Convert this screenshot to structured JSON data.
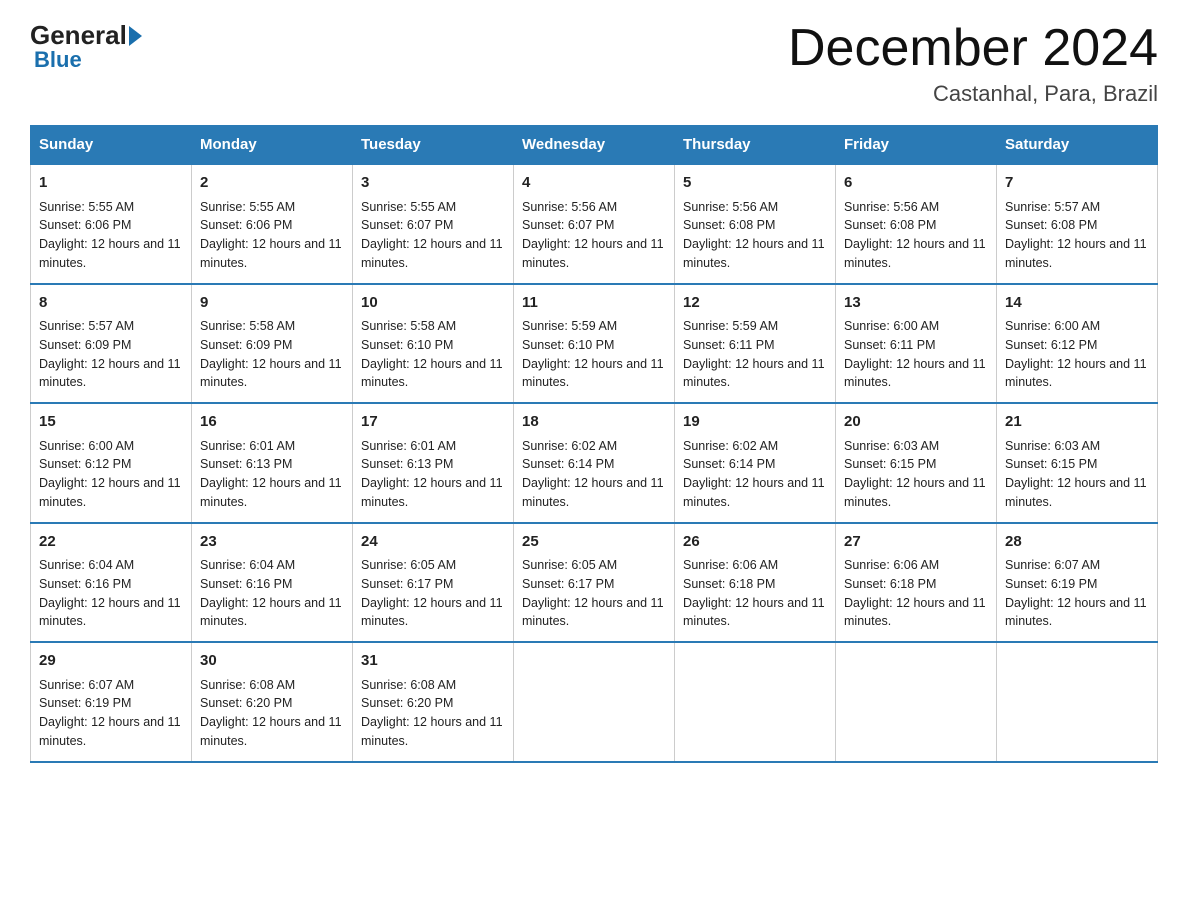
{
  "header": {
    "logo_general": "General",
    "logo_blue": "Blue",
    "title": "December 2024",
    "location": "Castanhal, Para, Brazil"
  },
  "days_of_week": [
    "Sunday",
    "Monday",
    "Tuesday",
    "Wednesday",
    "Thursday",
    "Friday",
    "Saturday"
  ],
  "weeks": [
    [
      {
        "day": "1",
        "sunrise": "5:55 AM",
        "sunset": "6:06 PM",
        "daylight": "12 hours and 11 minutes."
      },
      {
        "day": "2",
        "sunrise": "5:55 AM",
        "sunset": "6:06 PM",
        "daylight": "12 hours and 11 minutes."
      },
      {
        "day": "3",
        "sunrise": "5:55 AM",
        "sunset": "6:07 PM",
        "daylight": "12 hours and 11 minutes."
      },
      {
        "day": "4",
        "sunrise": "5:56 AM",
        "sunset": "6:07 PM",
        "daylight": "12 hours and 11 minutes."
      },
      {
        "day": "5",
        "sunrise": "5:56 AM",
        "sunset": "6:08 PM",
        "daylight": "12 hours and 11 minutes."
      },
      {
        "day": "6",
        "sunrise": "5:56 AM",
        "sunset": "6:08 PM",
        "daylight": "12 hours and 11 minutes."
      },
      {
        "day": "7",
        "sunrise": "5:57 AM",
        "sunset": "6:08 PM",
        "daylight": "12 hours and 11 minutes."
      }
    ],
    [
      {
        "day": "8",
        "sunrise": "5:57 AM",
        "sunset": "6:09 PM",
        "daylight": "12 hours and 11 minutes."
      },
      {
        "day": "9",
        "sunrise": "5:58 AM",
        "sunset": "6:09 PM",
        "daylight": "12 hours and 11 minutes."
      },
      {
        "day": "10",
        "sunrise": "5:58 AM",
        "sunset": "6:10 PM",
        "daylight": "12 hours and 11 minutes."
      },
      {
        "day": "11",
        "sunrise": "5:59 AM",
        "sunset": "6:10 PM",
        "daylight": "12 hours and 11 minutes."
      },
      {
        "day": "12",
        "sunrise": "5:59 AM",
        "sunset": "6:11 PM",
        "daylight": "12 hours and 11 minutes."
      },
      {
        "day": "13",
        "sunrise": "6:00 AM",
        "sunset": "6:11 PM",
        "daylight": "12 hours and 11 minutes."
      },
      {
        "day": "14",
        "sunrise": "6:00 AM",
        "sunset": "6:12 PM",
        "daylight": "12 hours and 11 minutes."
      }
    ],
    [
      {
        "day": "15",
        "sunrise": "6:00 AM",
        "sunset": "6:12 PM",
        "daylight": "12 hours and 11 minutes."
      },
      {
        "day": "16",
        "sunrise": "6:01 AM",
        "sunset": "6:13 PM",
        "daylight": "12 hours and 11 minutes."
      },
      {
        "day": "17",
        "sunrise": "6:01 AM",
        "sunset": "6:13 PM",
        "daylight": "12 hours and 11 minutes."
      },
      {
        "day": "18",
        "sunrise": "6:02 AM",
        "sunset": "6:14 PM",
        "daylight": "12 hours and 11 minutes."
      },
      {
        "day": "19",
        "sunrise": "6:02 AM",
        "sunset": "6:14 PM",
        "daylight": "12 hours and 11 minutes."
      },
      {
        "day": "20",
        "sunrise": "6:03 AM",
        "sunset": "6:15 PM",
        "daylight": "12 hours and 11 minutes."
      },
      {
        "day": "21",
        "sunrise": "6:03 AM",
        "sunset": "6:15 PM",
        "daylight": "12 hours and 11 minutes."
      }
    ],
    [
      {
        "day": "22",
        "sunrise": "6:04 AM",
        "sunset": "6:16 PM",
        "daylight": "12 hours and 11 minutes."
      },
      {
        "day": "23",
        "sunrise": "6:04 AM",
        "sunset": "6:16 PM",
        "daylight": "12 hours and 11 minutes."
      },
      {
        "day": "24",
        "sunrise": "6:05 AM",
        "sunset": "6:17 PM",
        "daylight": "12 hours and 11 minutes."
      },
      {
        "day": "25",
        "sunrise": "6:05 AM",
        "sunset": "6:17 PM",
        "daylight": "12 hours and 11 minutes."
      },
      {
        "day": "26",
        "sunrise": "6:06 AM",
        "sunset": "6:18 PM",
        "daylight": "12 hours and 11 minutes."
      },
      {
        "day": "27",
        "sunrise": "6:06 AM",
        "sunset": "6:18 PM",
        "daylight": "12 hours and 11 minutes."
      },
      {
        "day": "28",
        "sunrise": "6:07 AM",
        "sunset": "6:19 PM",
        "daylight": "12 hours and 11 minutes."
      }
    ],
    [
      {
        "day": "29",
        "sunrise": "6:07 AM",
        "sunset": "6:19 PM",
        "daylight": "12 hours and 11 minutes."
      },
      {
        "day": "30",
        "sunrise": "6:08 AM",
        "sunset": "6:20 PM",
        "daylight": "12 hours and 11 minutes."
      },
      {
        "day": "31",
        "sunrise": "6:08 AM",
        "sunset": "6:20 PM",
        "daylight": "12 hours and 11 minutes."
      },
      null,
      null,
      null,
      null
    ]
  ],
  "labels": {
    "sunrise": "Sunrise:",
    "sunset": "Sunset:",
    "daylight": "Daylight:"
  }
}
